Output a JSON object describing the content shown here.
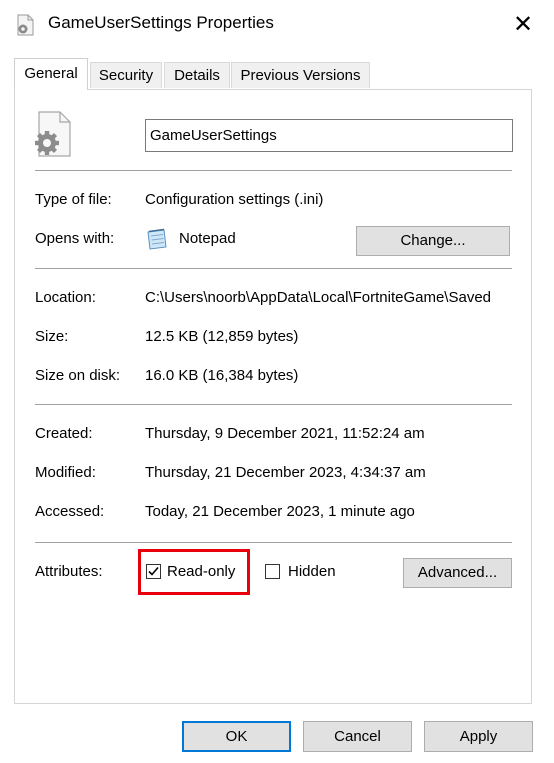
{
  "window": {
    "title": "GameUserSettings Properties",
    "close_glyph": "✕"
  },
  "tabs": [
    {
      "label": "General",
      "active": true
    },
    {
      "label": "Security",
      "active": false
    },
    {
      "label": "Details",
      "active": false
    },
    {
      "label": "Previous Versions",
      "active": false
    }
  ],
  "file": {
    "name": "GameUserSettings",
    "icon": "settings-file-icon"
  },
  "type_info": {
    "type_label": "Type of file:",
    "type_value": "Configuration settings (.ini)",
    "opens_label": "Opens with:",
    "opens_value": "Notepad",
    "opens_icon": "notepad-icon",
    "change_label": "Change..."
  },
  "location_info": {
    "location_label": "Location:",
    "location_value": "C:\\Users\\noorb\\AppData\\Local\\FortniteGame\\Saved",
    "size_label": "Size:",
    "size_value": "12.5 KB (12,859 bytes)",
    "size_disk_label": "Size on disk:",
    "size_disk_value": "16.0 KB (16,384 bytes)"
  },
  "dates": {
    "created_label": "Created:",
    "created_value": "Thursday, 9 December 2021, 11:52:24 am",
    "modified_label": "Modified:",
    "modified_value": "Thursday, 21 December 2023, 4:34:37 am",
    "accessed_label": "Accessed:",
    "accessed_value": "Today, 21 December 2023, 1 minute ago"
  },
  "attributes": {
    "label": "Attributes:",
    "readonly_label": "Read-only",
    "readonly_checked": true,
    "hidden_label": "Hidden",
    "hidden_checked": false,
    "advanced_label": "Advanced...",
    "highlight_color": "#e8000b"
  },
  "footer": {
    "ok_label": "OK",
    "cancel_label": "Cancel",
    "apply_label": "Apply"
  }
}
